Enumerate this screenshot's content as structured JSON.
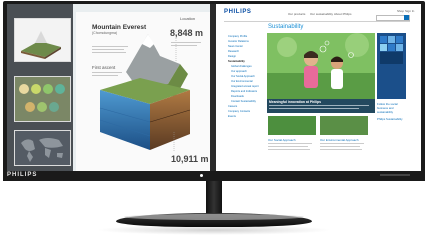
{
  "monitor": {
    "brand": "PHILIPS",
    "osd_buttons": [
      "",
      "",
      "",
      ""
    ]
  },
  "left_screen": {
    "title": "Mountain Everest",
    "subtitle": "(Chomolungma)",
    "height_value": "8,848 m",
    "location": "Location",
    "first_ascent": "First ascent",
    "depth_value": "10,911 m"
  },
  "right_screen": {
    "logo": "PHILIPS",
    "nav": [
      "Our products",
      "Our sustainability",
      "About Philips"
    ],
    "top_links": [
      "Shop",
      "Sign In"
    ],
    "section_title": "Sustainability",
    "side_menu": [
      "Company Profile",
      "Investor Relations",
      "News Center",
      "Research",
      "Design",
      "Sustainability",
      "Global challenges",
      "Our approach",
      "Our Social Approach",
      "Our Environmental",
      "Integrated annual report",
      "Reports and Indicators",
      "Downloads",
      "Contact Sustainability",
      "",
      "Careers",
      "Company Contacts",
      "Events"
    ],
    "hero_caption": "Meaningful innovation at Philips",
    "tile_1_title": "Our Social Approach",
    "tile_2_title": "Our Environmental Approach",
    "right_rail": [
      "Follow the social business and sustainability",
      "Philips Sustainability"
    ]
  }
}
